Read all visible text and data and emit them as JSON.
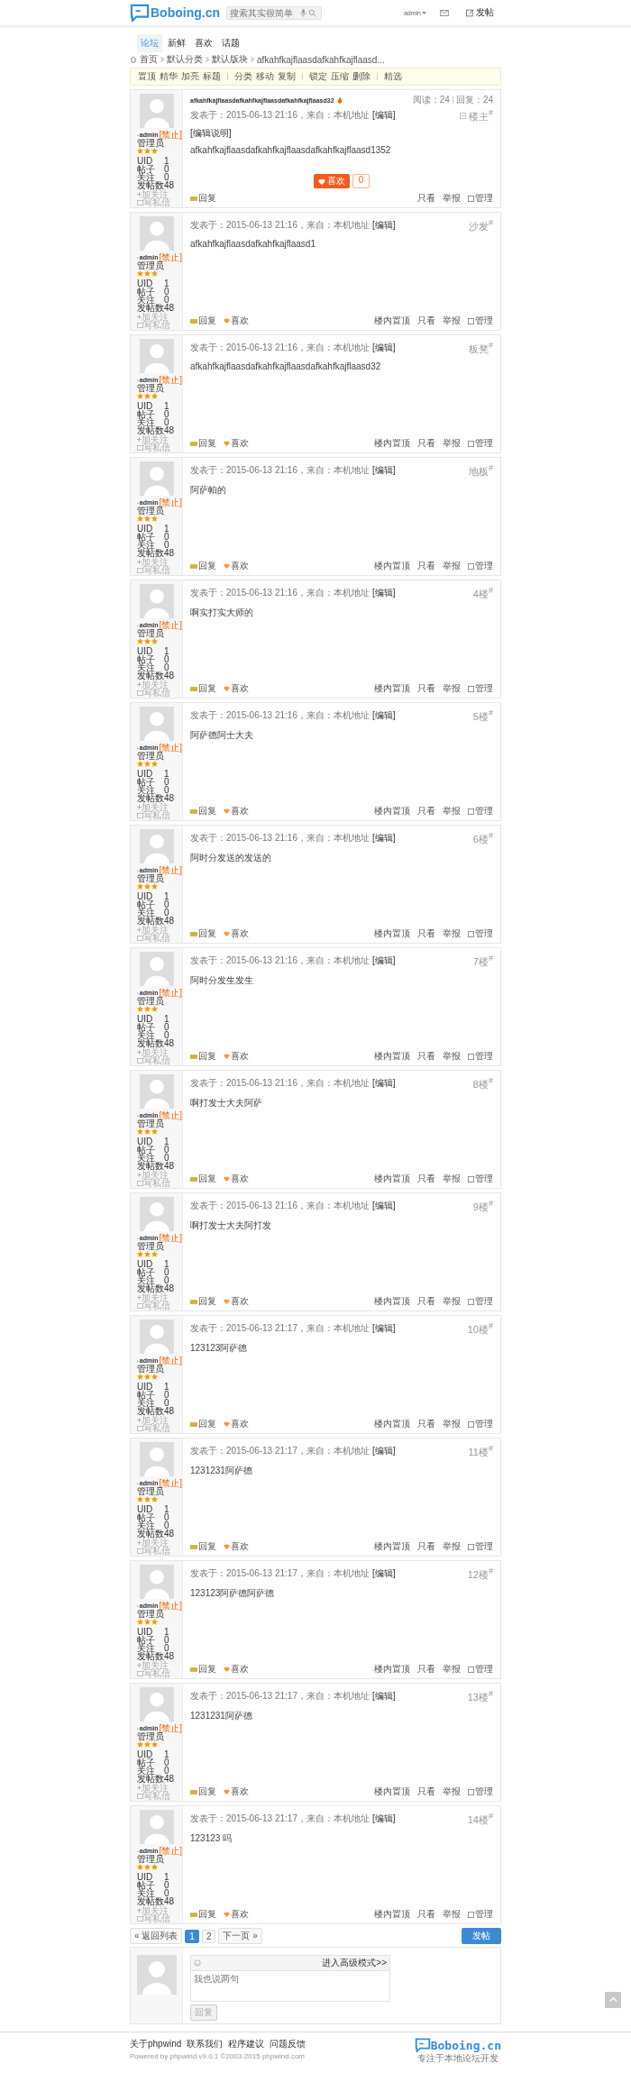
{
  "header": {
    "logo": "Boboing.cn",
    "search": {
      "placeholder": "搜索其实很简单"
    },
    "user": "admin",
    "post_link": "发帖"
  },
  "nav": {
    "tabs": [
      {
        "label": "论坛",
        "selected": true
      },
      {
        "label": "新鲜",
        "selected": false
      },
      {
        "label": "喜欢",
        "selected": false
      },
      {
        "label": "话题",
        "selected": false
      }
    ]
  },
  "breadcrumb": [
    "首页",
    "默认分类",
    "默认版块",
    "afkahfkajflaasdafkahfkajflaasd..."
  ],
  "toolbar": [
    [
      "置顶",
      "精华",
      "加亮",
      "标题"
    ],
    [
      "分类",
      "移动",
      "复制"
    ],
    [
      "锁定",
      "压缩",
      "删除"
    ],
    [
      "精选"
    ]
  ],
  "thread": {
    "title": "afkahfkajflaasdafkahfkajflaasdafkahfkajflaasd32",
    "views": "阅读：24",
    "replies": "回复：24"
  },
  "posts": [
    {
      "floor": "楼主$^{#}$",
      "meta": "发表于：2015-06-13 21:16，来自：本机地址",
      "edit": "[编辑]",
      "edit_note": "[编辑说明]",
      "content": "afkahfkajflaasdafkahfkajflaasdafkahfkajflaasd1352",
      "like": {
        "label": "喜欢",
        "count": "0"
      },
      "actions_left": [
        "回复"
      ],
      "actions_right": [
        "只看",
        "举报",
        "管理"
      ],
      "author": {
        "name": "admin",
        "tag": "[禁止]",
        "role": "管理员",
        "stars": 3,
        "stats": [
          [
            "UID",
            "1"
          ],
          [
            "帖子",
            "0"
          ],
          [
            "关注",
            "0"
          ],
          [
            "发帖数",
            "48"
          ]
        ],
        "follow": "加关注",
        "message": "写私信"
      }
    },
    {
      "floor": "沙发$^{#}$",
      "meta": "发表于：2015-06-13 21:16，来自：本机地址",
      "edit": "[编辑]",
      "content": "afkahfkajflaasdafkahfkajflaasd1",
      "actions_left": [
        "回复",
        "喜欢"
      ],
      "actions_right": [
        "楼内置顶",
        "只看",
        "举报",
        "管理"
      ],
      "author": {
        "name": "admin",
        "tag": "[禁止]",
        "role": "管理员",
        "stars": 3,
        "stats": [
          [
            "UID",
            "1"
          ],
          [
            "帖子",
            "0"
          ],
          [
            "关注",
            "0"
          ],
          [
            "发帖数",
            "48"
          ]
        ],
        "follow": "加关注",
        "message": "写私信"
      }
    },
    {
      "floor": "板凳$^{#}$",
      "meta": "发表于：2015-06-13 21:16，来自：本机地址",
      "edit": "[编辑]",
      "content": "afkahfkajflaasdafkahfkajflaasdafkahfkajflaasd32",
      "actions_left": [
        "回复",
        "喜欢"
      ],
      "actions_right": [
        "楼内置顶",
        "只看",
        "举报",
        "管理"
      ],
      "author": {
        "name": "admin",
        "tag": "[禁止]",
        "role": "管理员",
        "stars": 3,
        "stats": [
          [
            "UID",
            "1"
          ],
          [
            "帖子",
            "0"
          ],
          [
            "关注",
            "0"
          ],
          [
            "发帖数",
            "48"
          ]
        ],
        "follow": "加关注",
        "message": "写私信"
      }
    },
    {
      "floor": "地板$^{#}$",
      "meta": "发表于：2015-06-13 21:16，来自：本机地址",
      "edit": "[编辑]",
      "content": "阿萨帕的",
      "actions_left": [
        "回复",
        "喜欢"
      ],
      "actions_right": [
        "楼内置顶",
        "只看",
        "举报",
        "管理"
      ],
      "author": {
        "name": "admin",
        "tag": "[禁止]",
        "role": "管理员",
        "stars": 3,
        "stats": [
          [
            "UID",
            "1"
          ],
          [
            "帖子",
            "0"
          ],
          [
            "关注",
            "0"
          ],
          [
            "发帖数",
            "48"
          ]
        ],
        "follow": "加关注",
        "message": "写私信"
      }
    },
    {
      "floor": "4楼$^{#}$",
      "meta": "发表于：2015-06-13 21:16，来自：本机地址",
      "edit": "[编辑]",
      "content": "啊实打实大师的",
      "actions_left": [
        "回复",
        "喜欢"
      ],
      "actions_right": [
        "楼内置顶",
        "只看",
        "举报",
        "管理"
      ],
      "author": {
        "name": "admin",
        "tag": "[禁止]",
        "role": "管理员",
        "stars": 3,
        "stats": [
          [
            "UID",
            "1"
          ],
          [
            "帖子",
            "0"
          ],
          [
            "关注",
            "0"
          ],
          [
            "发帖数",
            "48"
          ]
        ],
        "follow": "加关注",
        "message": "写私信"
      }
    },
    {
      "floor": "5楼$^{#}$",
      "meta": "发表于：2015-06-13 21:16，来自：本机地址",
      "edit": "[编辑]",
      "content": "阿萨德阿士大夫",
      "actions_left": [
        "回复",
        "喜欢"
      ],
      "actions_right": [
        "楼内置顶",
        "只看",
        "举报",
        "管理"
      ],
      "author": {
        "name": "admin",
        "tag": "[禁止]",
        "role": "管理员",
        "stars": 3,
        "stats": [
          [
            "UID",
            "1"
          ],
          [
            "帖子",
            "0"
          ],
          [
            "关注",
            "0"
          ],
          [
            "发帖数",
            "48"
          ]
        ],
        "follow": "加关注",
        "message": "写私信"
      }
    },
    {
      "floor": "6楼$^{#}$",
      "meta": "发表于：2015-06-13 21:16，来自：本机地址",
      "edit": "[编辑]",
      "content": "阿时分发送的发送的",
      "actions_left": [
        "回复",
        "喜欢"
      ],
      "actions_right": [
        "楼内置顶",
        "只看",
        "举报",
        "管理"
      ],
      "author": {
        "name": "admin",
        "tag": "[禁止]",
        "role": "管理员",
        "stars": 3,
        "stats": [
          [
            "UID",
            "1"
          ],
          [
            "帖子",
            "0"
          ],
          [
            "关注",
            "0"
          ],
          [
            "发帖数",
            "48"
          ]
        ],
        "follow": "加关注",
        "message": "写私信"
      }
    },
    {
      "floor": "7楼$^{#}$",
      "meta": "发表于：2015-06-13 21:16，来自：本机地址",
      "edit": "[编辑]",
      "content": "阿时分发生发生",
      "actions_left": [
        "回复",
        "喜欢"
      ],
      "actions_right": [
        "楼内置顶",
        "只看",
        "举报",
        "管理"
      ],
      "author": {
        "name": "admin",
        "tag": "[禁止]",
        "role": "管理员",
        "stars": 3,
        "stats": [
          [
            "UID",
            "1"
          ],
          [
            "帖子",
            "0"
          ],
          [
            "关注",
            "0"
          ],
          [
            "发帖数",
            "48"
          ]
        ],
        "follow": "加关注",
        "message": "写私信"
      }
    },
    {
      "floor": "8楼$^{#}$",
      "meta": "发表于：2015-06-13 21:16，来自：本机地址",
      "edit": "[编辑]",
      "content": "啊打发士大夫阿萨",
      "actions_left": [
        "回复",
        "喜欢"
      ],
      "actions_right": [
        "楼内置顶",
        "只看",
        "举报",
        "管理"
      ],
      "author": {
        "name": "admin",
        "tag": "[禁止]",
        "role": "管理员",
        "stars": 3,
        "stats": [
          [
            "UID",
            "1"
          ],
          [
            "帖子",
            "0"
          ],
          [
            "关注",
            "0"
          ],
          [
            "发帖数",
            "48"
          ]
        ],
        "follow": "加关注",
        "message": "写私信"
      }
    },
    {
      "floor": "9楼$^{#}$",
      "meta": "发表于：2015-06-13 21:16，来自：本机地址",
      "edit": "[编辑]",
      "content": "啊打发士大夫阿打发",
      "actions_left": [
        "回复",
        "喜欢"
      ],
      "actions_right": [
        "楼内置顶",
        "只看",
        "举报",
        "管理"
      ],
      "author": {
        "name": "admin",
        "tag": "[禁止]",
        "role": "管理员",
        "stars": 3,
        "stats": [
          [
            "UID",
            "1"
          ],
          [
            "帖子",
            "0"
          ],
          [
            "关注",
            "0"
          ],
          [
            "发帖数",
            "48"
          ]
        ],
        "follow": "加关注",
        "message": "写私信"
      }
    },
    {
      "floor": "10楼$^{#}$",
      "meta": "发表于：2015-06-13 21:17，来自：本机地址",
      "edit": "[编辑]",
      "content": "123123阿萨德",
      "actions_left": [
        "回复",
        "喜欢"
      ],
      "actions_right": [
        "楼内置顶",
        "只看",
        "举报",
        "管理"
      ],
      "author": {
        "name": "admin",
        "tag": "[禁止]",
        "role": "管理员",
        "stars": 3,
        "stats": [
          [
            "UID",
            "1"
          ],
          [
            "帖子",
            "0"
          ],
          [
            "关注",
            "0"
          ],
          [
            "发帖数",
            "48"
          ]
        ],
        "follow": "加关注",
        "message": "写私信"
      }
    },
    {
      "floor": "11楼$^{#}$",
      "meta": "发表于：2015-06-13 21:17，来自：本机地址",
      "edit": "[编辑]",
      "content": "1231231阿萨德",
      "actions_left": [
        "回复",
        "喜欢"
      ],
      "actions_right": [
        "楼内置顶",
        "只看",
        "举报",
        "管理"
      ],
      "author": {
        "name": "admin",
        "tag": "[禁止]",
        "role": "管理员",
        "stars": 3,
        "stats": [
          [
            "UID",
            "1"
          ],
          [
            "帖子",
            "0"
          ],
          [
            "关注",
            "0"
          ],
          [
            "发帖数",
            "48"
          ]
        ],
        "follow": "加关注",
        "message": "写私信"
      }
    },
    {
      "floor": "12楼$^{#}$",
      "meta": "发表于：2015-06-13 21:17，来自：本机地址",
      "edit": "[编辑]",
      "content": "123123阿萨德阿萨德",
      "actions_left": [
        "回复",
        "喜欢"
      ],
      "actions_right": [
        "楼内置顶",
        "只看",
        "举报",
        "管理"
      ],
      "author": {
        "name": "admin",
        "tag": "[禁止]",
        "role": "管理员",
        "stars": 3,
        "stats": [
          [
            "UID",
            "1"
          ],
          [
            "帖子",
            "0"
          ],
          [
            "关注",
            "0"
          ],
          [
            "发帖数",
            "48"
          ]
        ],
        "follow": "加关注",
        "message": "写私信"
      }
    },
    {
      "floor": "13楼$^{#}$",
      "meta": "发表于：2015-06-13 21:17，来自：本机地址",
      "edit": "[编辑]",
      "content": "1231231阿萨德",
      "actions_left": [
        "回复",
        "喜欢"
      ],
      "actions_right": [
        "楼内置顶",
        "只看",
        "举报",
        "管理"
      ],
      "author": {
        "name": "admin",
        "tag": "[禁止]",
        "role": "管理员",
        "stars": 3,
        "stats": [
          [
            "UID",
            "1"
          ],
          [
            "帖子",
            "0"
          ],
          [
            "关注",
            "0"
          ],
          [
            "发帖数",
            "48"
          ]
        ],
        "follow": "加关注",
        "message": "写私信"
      }
    },
    {
      "floor": "14楼$^{#}$",
      "meta": "发表于：2015-06-13 21:17，来自：本机地址",
      "edit": "[编辑]",
      "content": "123123 吗",
      "actions_left": [
        "回复",
        "喜欢"
      ],
      "actions_right": [
        "楼内置顶",
        "只看",
        "举报",
        "管理"
      ],
      "author": {
        "name": "admin",
        "tag": "[禁止]",
        "role": "管理员",
        "stars": 3,
        "stats": [
          [
            "UID",
            "1"
          ],
          [
            "帖子",
            "0"
          ],
          [
            "关注",
            "0"
          ],
          [
            "发帖数",
            "48"
          ]
        ],
        "follow": "加关注",
        "message": "写私信"
      }
    }
  ],
  "pagination": {
    "back": "« 返回列表",
    "pages": [
      {
        "label": "1",
        "selected": true
      },
      {
        "label": "2",
        "selected": false
      }
    ],
    "next": "下一页 »",
    "new_post": "发帖"
  },
  "reply": {
    "advanced": "进入高级模式>>",
    "placeholder": "我也说两句",
    "submit": {
      "label": "回复",
      "disabled": true
    }
  },
  "footer": {
    "links": [
      "关于phpwind",
      "联系我们",
      "程序建议",
      "问题反馈"
    ],
    "powered": "Powered by phpwind v9.0.1 ©2003-2015 phpwind.com",
    "logo": "Boboing.cn",
    "slogan": "专注于本地论坛开发"
  }
}
